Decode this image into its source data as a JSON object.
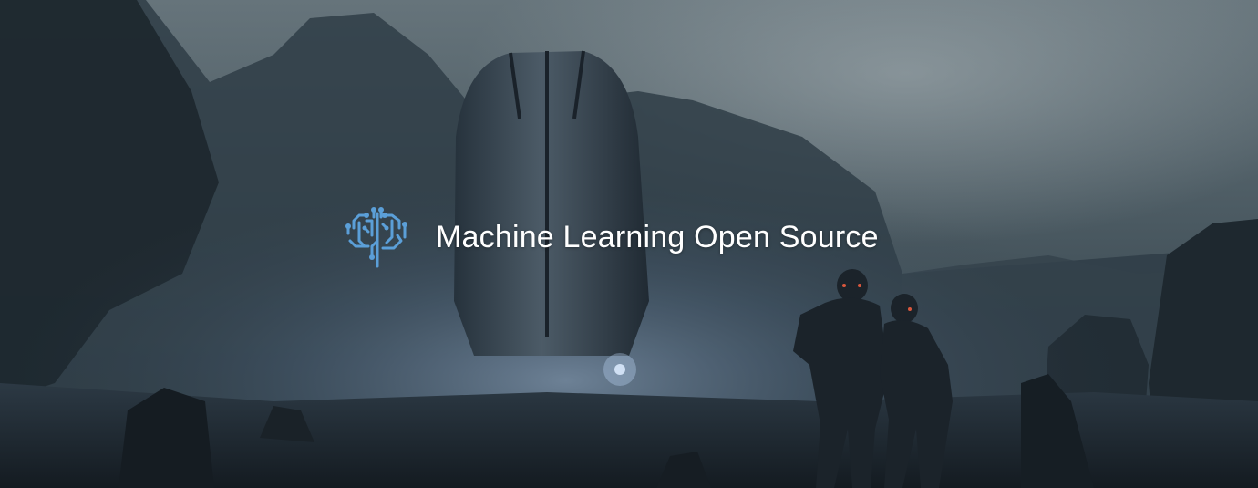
{
  "banner": {
    "title": "Machine Learning Open Source",
    "logo_icon": "brain-circuit-icon",
    "logo_color": "#5b9fd8",
    "title_color": "#ffffff"
  }
}
